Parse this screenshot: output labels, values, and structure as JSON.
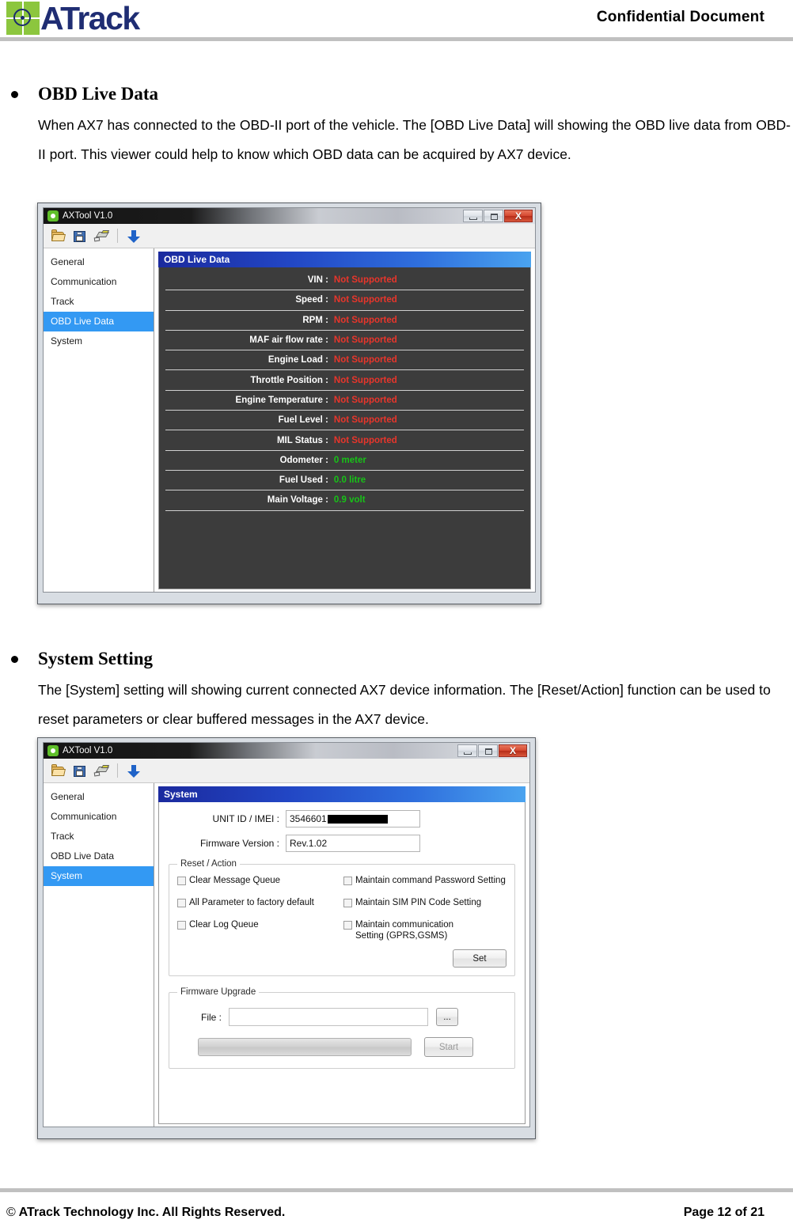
{
  "header": {
    "logo_text": "ATrack",
    "confidential": "Confidential  Document"
  },
  "sections": [
    {
      "title": "OBD Live Data",
      "paragraph": "When AX7 has connected to the OBD-II port of the vehicle. The [OBD Live Data] will showing the OBD live data from OBD-II port. This viewer could help to know which OBD data can be acquired by AX7 device."
    },
    {
      "title": "System Setting",
      "paragraph": "The [System] setting will showing current connected AX7 device information. The [Reset/Action] function can be used to reset parameters or clear buffered messages in the AX7 device."
    }
  ],
  "app": {
    "title": "AXTool V1.0",
    "window_buttons": {
      "minimize": "minimize",
      "maximize": "maximize",
      "close": "X"
    },
    "toolbar_icons": [
      "open-folder-icon",
      "save-disk-icon",
      "pen-icon",
      "download-arrow-icon"
    ],
    "sidebar_items": [
      "General",
      "Communication",
      "Track",
      "OBD Live Data",
      "System"
    ]
  },
  "screenshot1": {
    "active_sidebar": "OBD Live Data",
    "panel_title": "OBD Live Data",
    "rows": [
      {
        "label": "VIN :",
        "value": "Not Supported",
        "state": "na"
      },
      {
        "label": "Speed :",
        "value": "Not Supported",
        "state": "na"
      },
      {
        "label": "RPM :",
        "value": "Not Supported",
        "state": "na"
      },
      {
        "label": "MAF air flow rate :",
        "value": "Not Supported",
        "state": "na"
      },
      {
        "label": "Engine Load :",
        "value": "Not Supported",
        "state": "na"
      },
      {
        "label": "Throttle Position :",
        "value": "Not Supported",
        "state": "na"
      },
      {
        "label": "Engine Temperature :",
        "value": "Not Supported",
        "state": "na"
      },
      {
        "label": "Fuel Level :",
        "value": "Not Supported",
        "state": "na"
      },
      {
        "label": "MIL Status :",
        "value": "Not Supported",
        "state": "na"
      },
      {
        "label": "Odometer :",
        "value": "0 meter",
        "state": "ok"
      },
      {
        "label": "Fuel Used :",
        "value": "0.0 litre",
        "state": "ok"
      },
      {
        "label": "Main Voltage :",
        "value": "0.9 volt",
        "state": "ok"
      }
    ]
  },
  "screenshot2": {
    "active_sidebar": "System",
    "panel_title": "System",
    "unit_id_label": "UNIT ID / IMEI :",
    "unit_id_value": "3546601",
    "firmware_label": "Firmware Version :",
    "firmware_value": "Rev.1.02",
    "reset_action": {
      "legend": "Reset / Action",
      "left_checkboxes": [
        {
          "label": "Clear Message Queue",
          "checked": false
        },
        {
          "label": "All Parameter to factory default",
          "checked": false
        },
        {
          "label": "Clear Log Queue",
          "checked": false
        }
      ],
      "right_checkboxes": [
        {
          "label": "Maintain command Password Setting",
          "checked": false
        },
        {
          "label": "Maintain SIM PIN Code Setting",
          "checked": false
        },
        {
          "label": "Maintain communication Setting (GPRS,GSMS)",
          "checked": false
        }
      ],
      "set_button": "Set"
    },
    "firmware_upgrade": {
      "legend": "Firmware Upgrade",
      "file_label": "File :",
      "file_value": "",
      "browse_button": "...",
      "start_button": "Start",
      "progress_percent": 0
    }
  },
  "footer": {
    "copyright": "ATrack Technology Inc. All Rights Reserved.",
    "page": "Page 12 of 21"
  }
}
